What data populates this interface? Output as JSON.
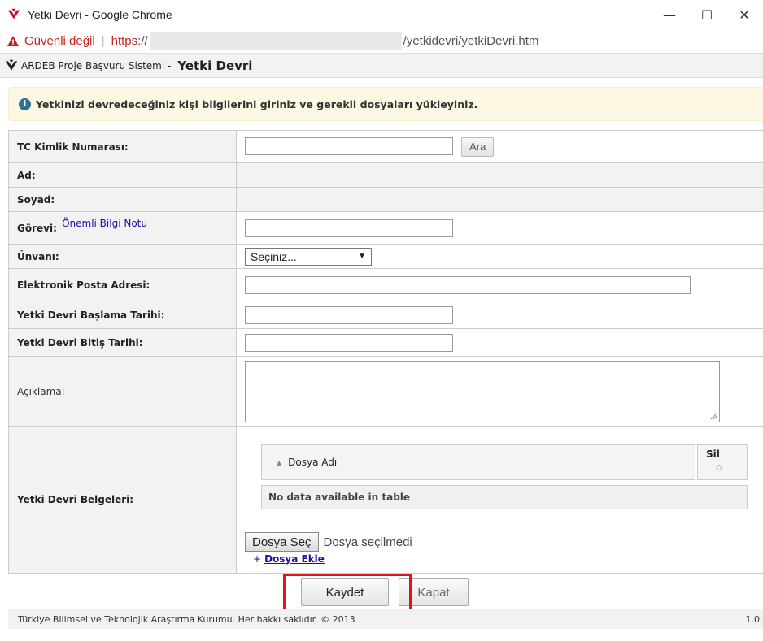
{
  "window": {
    "title": "Yetki Devri - Google Chrome",
    "minimize": "—",
    "maximize": "☐",
    "close": "✕"
  },
  "address": {
    "security_label": "Güvenli değil",
    "separator": "|",
    "scheme": "https",
    "scheme_sep": "://",
    "url_end": "/yetkidevri/yetkiDevri.htm"
  },
  "header": {
    "system_name": "ARDEB Proje Başvuru Sistemi -",
    "page_title": "Yetki Devri"
  },
  "info_message": "Yetkinizi devredeceğiniz kişi bilgilerini giriniz ve gerekli dosyaları yükleyiniz.",
  "form": {
    "tc_label": "TC Kimlik Numarası:",
    "tc_value": "",
    "search_button": "Ara",
    "ad_label": "Ad:",
    "soyad_label": "Soyad:",
    "gorev_label": "Görevi:",
    "gorev_note_link": "Önemli Bilgi Notu",
    "gorev_value": "",
    "unvan_label": "Ünvanı:",
    "unvan_selected": "Seçiniz...",
    "email_label": "Elektronik Posta Adresi:",
    "email_value": "",
    "start_label": "Yetki Devri Başlama Tarihi:",
    "start_value": "",
    "end_label": "Yetki Devri Bitiş Tarihi:",
    "end_value": "",
    "desc_label": "Açıklama:",
    "docs_label": "Yetki Devri Belgeleri:"
  },
  "docs_table": {
    "column_name": "Dosya Adı",
    "column_delete": "Sil",
    "empty_text": "No data available in table",
    "choose_file_button": "Dosya Seç",
    "no_file_text": "Dosya seçilmedi",
    "add_plus": "+",
    "add_file_link": "Dosya Ekle"
  },
  "actions": {
    "save": "Kaydet",
    "close": "Kapat"
  },
  "footer": {
    "copyright": "Türkiye Bilimsel ve Teknolojik Araştırma Kurumu. Her hakkı saklıdır. © 2013",
    "version": "1.0"
  },
  "colors": {
    "warning_red": "#c5221f",
    "link_blue": "#1a0dab",
    "info_bg": "#fcf8e3",
    "highlight_red": "#e0141e"
  }
}
